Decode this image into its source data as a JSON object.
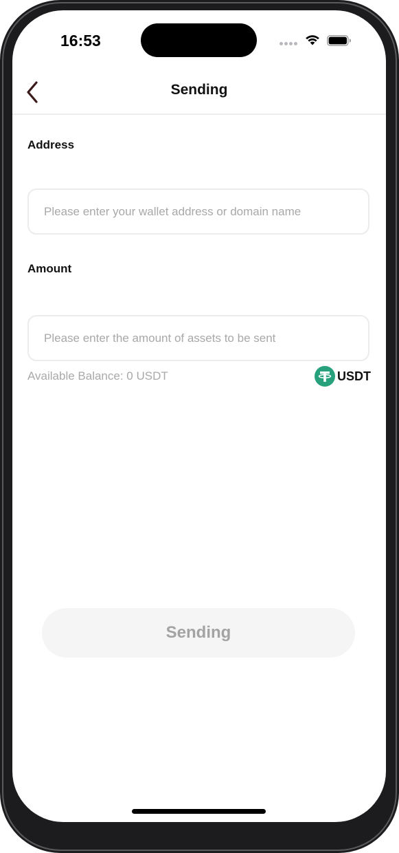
{
  "status_bar": {
    "time": "16:53"
  },
  "header": {
    "title": "Sending",
    "back_icon": "chevron-left-icon",
    "back_color": "#3a1a1a"
  },
  "form": {
    "address": {
      "label": "Address",
      "value": "",
      "placeholder": "Please enter your wallet address or domain name"
    },
    "amount": {
      "label": "Amount",
      "value": "",
      "placeholder": "Please enter the amount of assets to be sent"
    },
    "available_balance": "Available Balance: 0 USDT",
    "token": {
      "symbol": "USDT",
      "icon": "tether-icon",
      "icon_color": "#26a17b"
    }
  },
  "actions": {
    "send_label": "Sending"
  }
}
